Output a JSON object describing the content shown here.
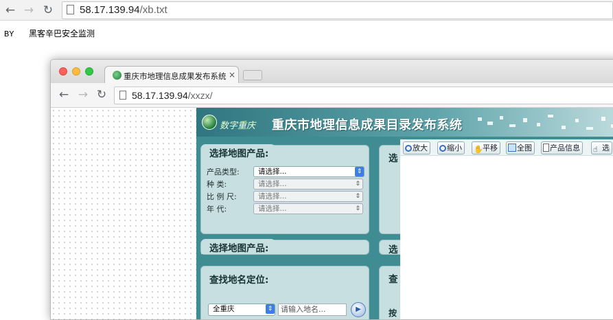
{
  "outer_browser": {
    "url_host": "58.17.139.94",
    "url_path": "/xb.txt"
  },
  "page_text": "BY   黑客辛巴安全监测",
  "inner_browser": {
    "tab_title": "重庆市地理信息成果发布系统",
    "tab_close": "×",
    "url_host": "58.17.139.94",
    "url_path": "/xxzx/"
  },
  "site": {
    "logo_text": "数字重庆",
    "title": "重庆市地理信息成果目录发布系统",
    "panel1": {
      "title": "选择地图产品:",
      "rows": [
        {
          "label": "产品类型:",
          "value": "请选择...",
          "active": true
        },
        {
          "label": "种      类:",
          "value": "请选择...",
          "active": false
        },
        {
          "label": "比 例 尺:",
          "value": "请选择...",
          "active": false
        },
        {
          "label": "年      代:",
          "value": "请选择...",
          "active": false
        }
      ]
    },
    "panel2": {
      "title": "选择地图产品:"
    },
    "panel3": {
      "title": "查找地名定位:",
      "region_value": "全重庆",
      "search_placeholder": "请输入地名..."
    },
    "side_titles": [
      "选",
      "选",
      "查",
      "按"
    ],
    "toolbar": [
      {
        "label": "放大",
        "icon": "zoom-in-icon"
      },
      {
        "label": "缩小",
        "icon": "zoom-out-icon"
      },
      {
        "label": "平移",
        "icon": "hand-icon"
      },
      {
        "label": "全图",
        "icon": "full-extent-icon"
      },
      {
        "label": "产品信息",
        "icon": "document-icon"
      },
      {
        "label": "选",
        "icon": "pointer-icon"
      }
    ]
  }
}
